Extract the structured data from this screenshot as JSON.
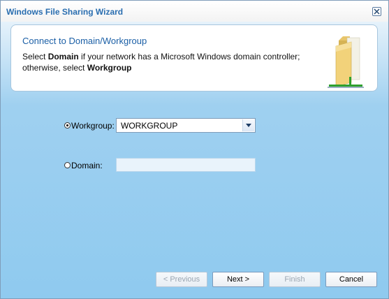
{
  "window": {
    "title": "Windows File Sharing Wizard",
    "close_icon": "close-icon"
  },
  "header": {
    "title": "Connect to Domain/Workgroup",
    "desc_1": "Select ",
    "desc_b1": "Domain",
    "desc_2": " if your network has a Microsoft Windows domain controller; otherwise, select ",
    "desc_b2": "Workgroup",
    "icon": "shared-folder-icon"
  },
  "form": {
    "workgroup_label": "Workgroup:",
    "workgroup_selected": true,
    "workgroup_value": "WORKGROUP",
    "domain_label": "Domain:",
    "domain_selected": false,
    "domain_value": ""
  },
  "buttons": {
    "previous": "< Previous",
    "next": "Next >",
    "finish": "Finish",
    "cancel": "Cancel"
  },
  "colors": {
    "title": "#2a6eb0",
    "header_title": "#1b5fa6",
    "background": "#8fcaef"
  }
}
